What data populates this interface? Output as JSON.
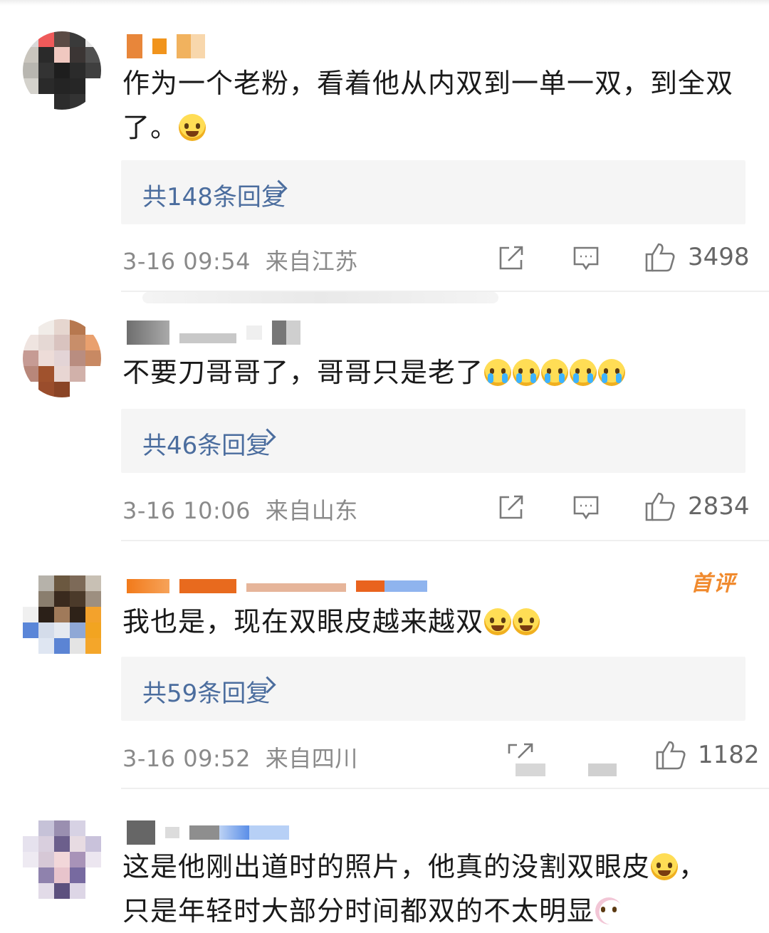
{
  "comments": [
    {
      "text_parts": [
        "作为一个老粉，看着他从内双到一单一双，到全双了。"
      ],
      "emoji": [
        "laugh-cry-emoji"
      ],
      "replies_label": "共148条回复",
      "date": "3-16 09:54",
      "location": "来自江苏",
      "likes": "3498"
    },
    {
      "text_parts": [
        "不要刀哥哥了，哥哥只是老了"
      ],
      "emoji": [
        "crying-emoji",
        "crying-emoji",
        "crying-emoji",
        "crying-emoji",
        "crying-emoji"
      ],
      "replies_label": "共46条回复",
      "date": "3-16 10:06",
      "location": "来自山东",
      "likes": "2834"
    },
    {
      "badge": "首评",
      "text_parts": [
        "我也是，现在双眼皮越来越双"
      ],
      "emoji": [
        "laugh-cry-emoji",
        "laugh-cry-emoji"
      ],
      "replies_label": "共59条回复",
      "date": "3-16 09:52",
      "location": "来自四川",
      "likes": "1182"
    },
    {
      "text_parts": [
        "这是他刚出道时的照片，他真的没割双眼皮",
        "，",
        "只是年轻时大部分时间都双的不太明显"
      ],
      "emoji": [
        "laugh-cry-emoji",
        "rabbit-emoji"
      ]
    }
  ],
  "icons": {
    "share": "share-icon",
    "comment": "comment-icon",
    "like": "thumbs-up-icon"
  },
  "colors": {
    "reply_link": "#4b6d9e",
    "meta": "#8a8a8a",
    "reply_box": "#f5f5f5",
    "first_comment_badge": "#f08a2e"
  }
}
